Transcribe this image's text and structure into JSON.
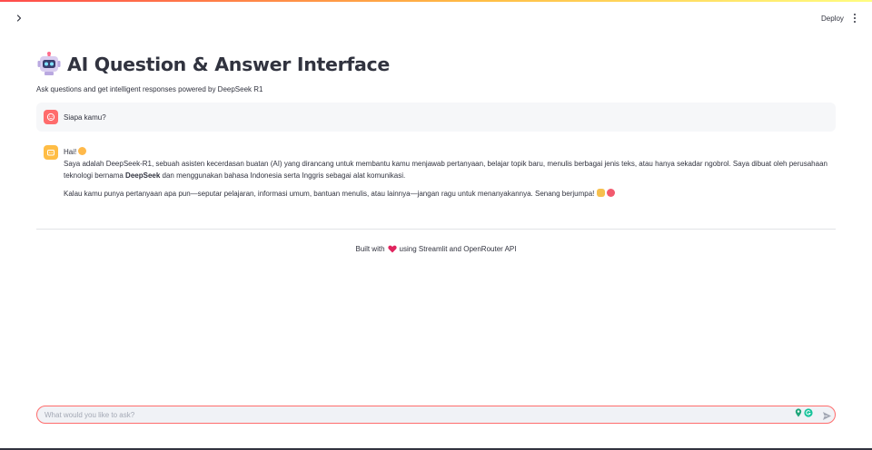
{
  "header": {
    "deploy_label": "Deploy"
  },
  "main": {
    "title": "AI Question & Answer Interface",
    "subtitle": "Ask questions and get intelligent responses powered by DeepSeek R1"
  },
  "messages": {
    "user": {
      "text": "Siapa kamu?"
    },
    "assistant": {
      "greeting": "Hai!",
      "p1_before": "Saya adalah DeepSeek-R1, sebuah asisten kecerdasan buatan (AI) yang dirancang untuk membantu kamu menjawab pertanyaan, belajar topik baru, menulis berbagai jenis teks, atau hanya sekadar ngobrol. Saya dibuat oleh perusahaan teknologi bernama ",
      "p1_bold": "DeepSeek",
      "p1_after": " dan menggunakan bahasa Indonesia serta Inggris sebagai alat komunikasi.",
      "p2": "Kalau kamu punya pertanyaan apa pun—seputar pelajaran, informasi umum, bantuan menulis, atau lainnya—jangan ragu untuk menanyakannya. Senang berjumpa!"
    }
  },
  "footer": {
    "prefix": "Built with",
    "suffix": "using Streamlit and OpenRouter API"
  },
  "chat_input": {
    "placeholder": "What would you like to ask?",
    "value": ""
  },
  "icons": {
    "sidebar_toggle": "chevron-right-icon",
    "menu": "kebab-menu-icon",
    "title": "robot-icon",
    "user_avatar": "user-avatar-icon",
    "assistant_avatar": "assistant-avatar-icon",
    "footer_heart": "heart-icon",
    "send": "send-icon"
  },
  "colors": {
    "accent": "#ff4b4b",
    "user_avatar": "#ff6c6c",
    "assistant_avatar": "#ffbd45",
    "text": "#31333f"
  }
}
